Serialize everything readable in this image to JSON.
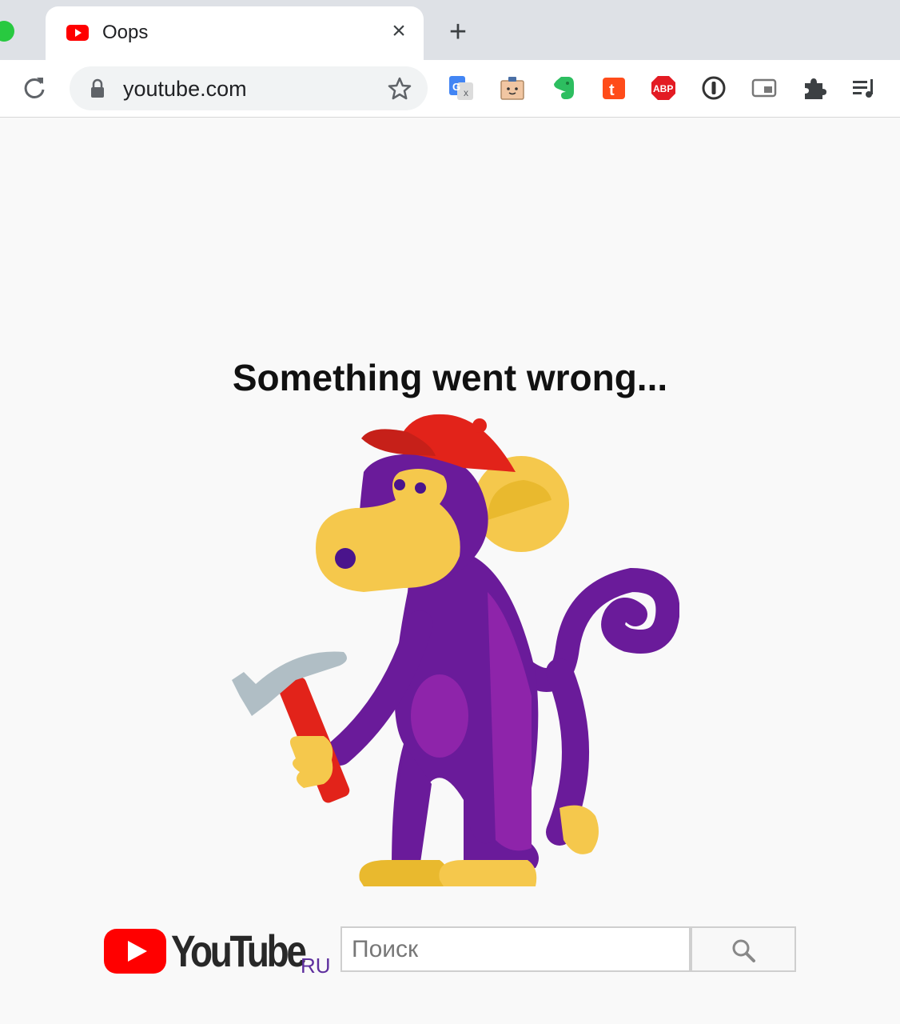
{
  "browser": {
    "tab": {
      "title": "Oops",
      "favicon": "youtube-icon",
      "close_label": "×"
    },
    "new_tab_label": "+",
    "address": {
      "url": "youtube.com"
    },
    "extensions": [
      "google-translate-icon",
      "toolbox-icon",
      "evernote-icon",
      "toggl-icon",
      "adblock-plus-icon",
      "onepassword-icon",
      "picture-in-picture-icon",
      "puzzle-extensions-icon",
      "playlist-icon"
    ]
  },
  "page": {
    "heading": "Something went wrong...",
    "illustration": "monkey-with-hammer"
  },
  "footer": {
    "logo_text": "YouTube",
    "region": "RU",
    "search": {
      "placeholder": "Поиск",
      "value": ""
    },
    "search_button_icon": "search-icon"
  },
  "colors": {
    "youtube_red": "#ff0000",
    "monkey_purple": "#6a1b9a",
    "monkey_yellow": "#f5c84c",
    "cap_red": "#e2231a",
    "page_bg": "#f9f9f9"
  }
}
